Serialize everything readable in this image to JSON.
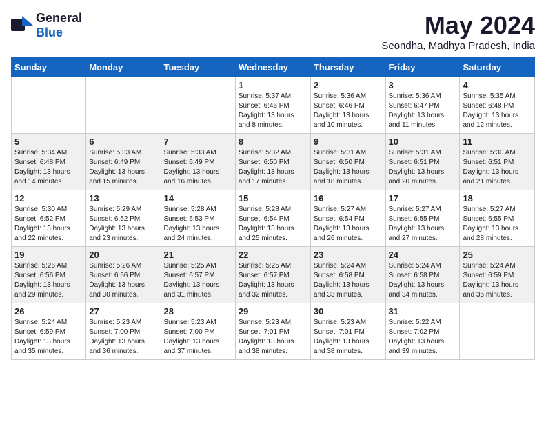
{
  "header": {
    "logo_general": "General",
    "logo_blue": "Blue",
    "month_title": "May 2024",
    "location": "Seondha, Madhya Pradesh, India"
  },
  "calendar": {
    "days_of_week": [
      "Sunday",
      "Monday",
      "Tuesday",
      "Wednesday",
      "Thursday",
      "Friday",
      "Saturday"
    ],
    "rows": [
      [
        {
          "day": "",
          "info": ""
        },
        {
          "day": "",
          "info": ""
        },
        {
          "day": "",
          "info": ""
        },
        {
          "day": "1",
          "info": "Sunrise: 5:37 AM\nSunset: 6:46 PM\nDaylight: 13 hours\nand 8 minutes."
        },
        {
          "day": "2",
          "info": "Sunrise: 5:36 AM\nSunset: 6:46 PM\nDaylight: 13 hours\nand 10 minutes."
        },
        {
          "day": "3",
          "info": "Sunrise: 5:36 AM\nSunset: 6:47 PM\nDaylight: 13 hours\nand 11 minutes."
        },
        {
          "day": "4",
          "info": "Sunrise: 5:35 AM\nSunset: 6:48 PM\nDaylight: 13 hours\nand 12 minutes."
        }
      ],
      [
        {
          "day": "5",
          "info": "Sunrise: 5:34 AM\nSunset: 6:48 PM\nDaylight: 13 hours\nand 14 minutes."
        },
        {
          "day": "6",
          "info": "Sunrise: 5:33 AM\nSunset: 6:49 PM\nDaylight: 13 hours\nand 15 minutes."
        },
        {
          "day": "7",
          "info": "Sunrise: 5:33 AM\nSunset: 6:49 PM\nDaylight: 13 hours\nand 16 minutes."
        },
        {
          "day": "8",
          "info": "Sunrise: 5:32 AM\nSunset: 6:50 PM\nDaylight: 13 hours\nand 17 minutes."
        },
        {
          "day": "9",
          "info": "Sunrise: 5:31 AM\nSunset: 6:50 PM\nDaylight: 13 hours\nand 18 minutes."
        },
        {
          "day": "10",
          "info": "Sunrise: 5:31 AM\nSunset: 6:51 PM\nDaylight: 13 hours\nand 20 minutes."
        },
        {
          "day": "11",
          "info": "Sunrise: 5:30 AM\nSunset: 6:51 PM\nDaylight: 13 hours\nand 21 minutes."
        }
      ],
      [
        {
          "day": "12",
          "info": "Sunrise: 5:30 AM\nSunset: 6:52 PM\nDaylight: 13 hours\nand 22 minutes."
        },
        {
          "day": "13",
          "info": "Sunrise: 5:29 AM\nSunset: 6:52 PM\nDaylight: 13 hours\nand 23 minutes."
        },
        {
          "day": "14",
          "info": "Sunrise: 5:28 AM\nSunset: 6:53 PM\nDaylight: 13 hours\nand 24 minutes."
        },
        {
          "day": "15",
          "info": "Sunrise: 5:28 AM\nSunset: 6:54 PM\nDaylight: 13 hours\nand 25 minutes."
        },
        {
          "day": "16",
          "info": "Sunrise: 5:27 AM\nSunset: 6:54 PM\nDaylight: 13 hours\nand 26 minutes."
        },
        {
          "day": "17",
          "info": "Sunrise: 5:27 AM\nSunset: 6:55 PM\nDaylight: 13 hours\nand 27 minutes."
        },
        {
          "day": "18",
          "info": "Sunrise: 5:27 AM\nSunset: 6:55 PM\nDaylight: 13 hours\nand 28 minutes."
        }
      ],
      [
        {
          "day": "19",
          "info": "Sunrise: 5:26 AM\nSunset: 6:56 PM\nDaylight: 13 hours\nand 29 minutes."
        },
        {
          "day": "20",
          "info": "Sunrise: 5:26 AM\nSunset: 6:56 PM\nDaylight: 13 hours\nand 30 minutes."
        },
        {
          "day": "21",
          "info": "Sunrise: 5:25 AM\nSunset: 6:57 PM\nDaylight: 13 hours\nand 31 minutes."
        },
        {
          "day": "22",
          "info": "Sunrise: 5:25 AM\nSunset: 6:57 PM\nDaylight: 13 hours\nand 32 minutes."
        },
        {
          "day": "23",
          "info": "Sunrise: 5:24 AM\nSunset: 6:58 PM\nDaylight: 13 hours\nand 33 minutes."
        },
        {
          "day": "24",
          "info": "Sunrise: 5:24 AM\nSunset: 6:58 PM\nDaylight: 13 hours\nand 34 minutes."
        },
        {
          "day": "25",
          "info": "Sunrise: 5:24 AM\nSunset: 6:59 PM\nDaylight: 13 hours\nand 35 minutes."
        }
      ],
      [
        {
          "day": "26",
          "info": "Sunrise: 5:24 AM\nSunset: 6:59 PM\nDaylight: 13 hours\nand 35 minutes."
        },
        {
          "day": "27",
          "info": "Sunrise: 5:23 AM\nSunset: 7:00 PM\nDaylight: 13 hours\nand 36 minutes."
        },
        {
          "day": "28",
          "info": "Sunrise: 5:23 AM\nSunset: 7:00 PM\nDaylight: 13 hours\nand 37 minutes."
        },
        {
          "day": "29",
          "info": "Sunrise: 5:23 AM\nSunset: 7:01 PM\nDaylight: 13 hours\nand 38 minutes."
        },
        {
          "day": "30",
          "info": "Sunrise: 5:23 AM\nSunset: 7:01 PM\nDaylight: 13 hours\nand 38 minutes."
        },
        {
          "day": "31",
          "info": "Sunrise: 5:22 AM\nSunset: 7:02 PM\nDaylight: 13 hours\nand 39 minutes."
        },
        {
          "day": "",
          "info": ""
        }
      ]
    ]
  }
}
